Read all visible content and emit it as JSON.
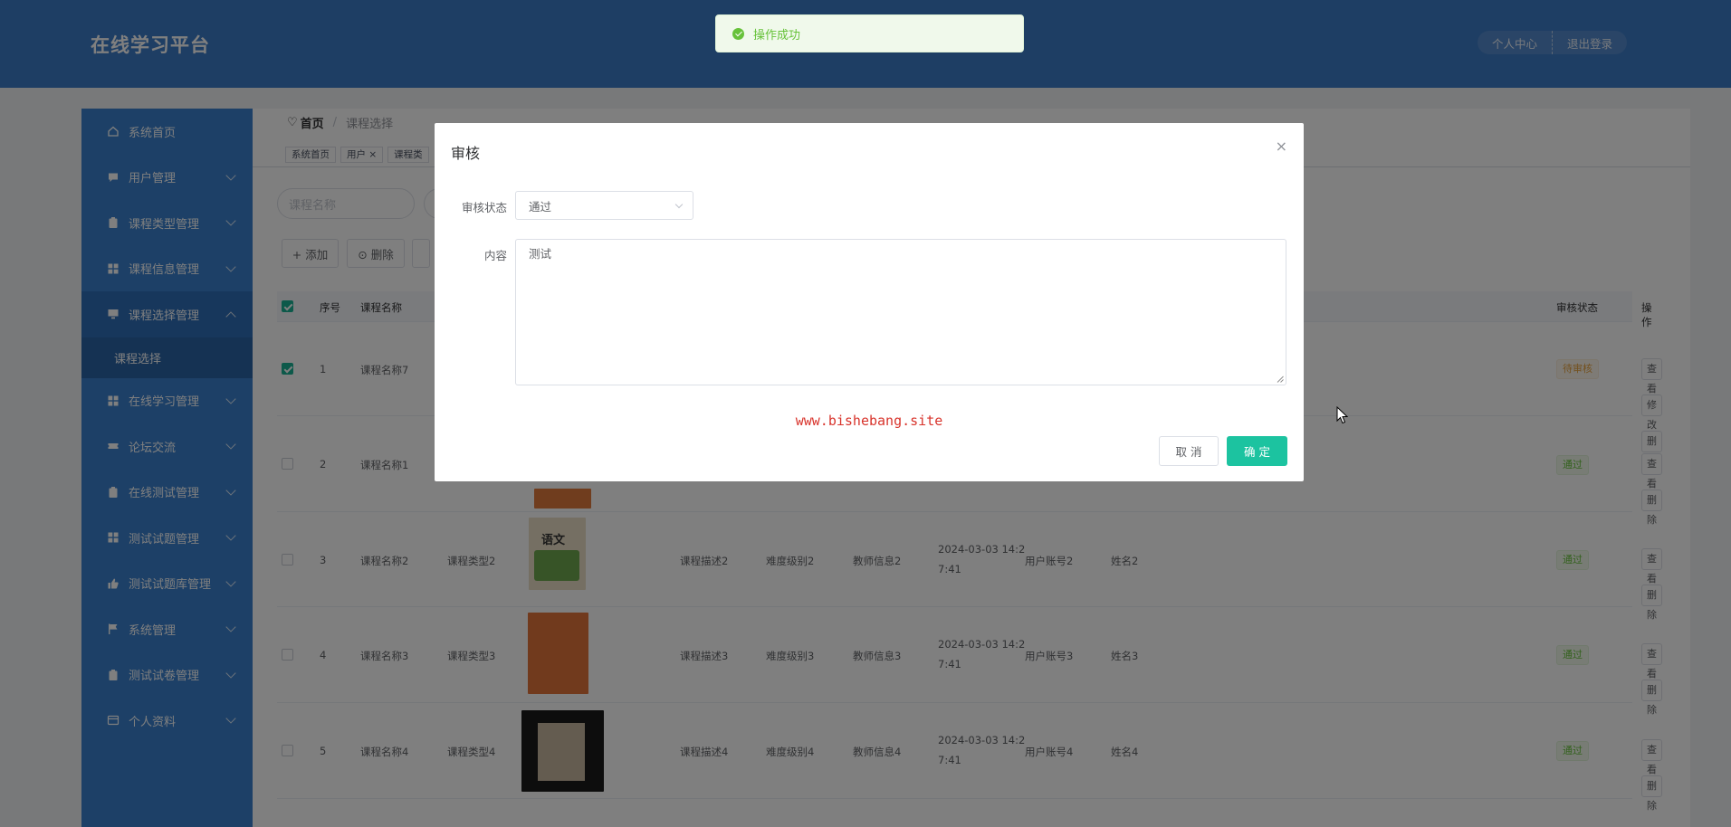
{
  "header": {
    "brand": "在线学习平台",
    "personal_center": "个人中心",
    "logout": "退出登录"
  },
  "sidebar": {
    "items": [
      {
        "label": "系统首页",
        "icon": "home-icon"
      },
      {
        "label": "用户管理",
        "icon": "chat-icon"
      },
      {
        "label": "课程类型管理",
        "icon": "clipboard-icon"
      },
      {
        "label": "课程信息管理",
        "icon": "grid-icon"
      },
      {
        "label": "课程选择管理",
        "icon": "monitor-icon"
      },
      {
        "label": "在线学习管理",
        "icon": "grid-icon"
      },
      {
        "label": "论坛交流",
        "icon": "ticket-icon"
      },
      {
        "label": "在线测试管理",
        "icon": "clipboard-icon"
      },
      {
        "label": "测试试题管理",
        "icon": "grid-icon"
      },
      {
        "label": "测试试题库管理",
        "icon": "thumb-icon"
      },
      {
        "label": "系统管理",
        "icon": "flag-icon"
      },
      {
        "label": "测试试卷管理",
        "icon": "clipboard-icon"
      },
      {
        "label": "个人资料",
        "icon": "card-icon"
      }
    ],
    "subitem": "课程选择"
  },
  "breadcrumb": {
    "home": "首页",
    "current": "课程选择"
  },
  "tags": [
    "系统首页",
    "用户 ×",
    "课程类"
  ],
  "search": {
    "placeholder": "课程名称"
  },
  "toolbar": {
    "add": "+ 添加",
    "delete": "⊙ 删除"
  },
  "table": {
    "headers": {
      "index": "序号",
      "name": "课程名称",
      "status": "审核状态",
      "ops": "操作"
    },
    "rows": [
      {
        "idx": "1",
        "name": "课程名称7",
        "type": "",
        "desc": "",
        "level": "",
        "teacher": "",
        "time1": "",
        "time2": "",
        "account": "",
        "user": "",
        "status": "待审核",
        "actions": [
          "查看",
          "修改",
          "删除"
        ],
        "checked": true
      },
      {
        "idx": "2",
        "name": "课程名称1",
        "type": "",
        "desc": "",
        "level": "",
        "teacher": "",
        "time1": "",
        "time2": "",
        "account": "",
        "user": "",
        "status": "通过",
        "actions": [
          "查看",
          "删除"
        ],
        "checked": false
      },
      {
        "idx": "3",
        "name": "课程名称2",
        "type": "课程类型2",
        "desc": "课程描述2",
        "level": "难度级别2",
        "teacher": "教师信息2",
        "time1": "2024-03-03 14:2",
        "time2": "7:41",
        "account": "用户账号2",
        "user": "姓名2",
        "status": "通过",
        "actions": [
          "查看",
          "删除"
        ],
        "checked": false
      },
      {
        "idx": "4",
        "name": "课程名称3",
        "type": "课程类型3",
        "desc": "课程描述3",
        "level": "难度级别3",
        "teacher": "教师信息3",
        "time1": "2024-03-03 14:2",
        "time2": "7:41",
        "account": "用户账号3",
        "user": "姓名3",
        "status": "通过",
        "actions": [
          "查看",
          "删除"
        ],
        "checked": false
      },
      {
        "idx": "5",
        "name": "课程名称4",
        "type": "课程类型4",
        "desc": "课程描述4",
        "level": "难度级别4",
        "teacher": "教师信息4",
        "time1": "2024-03-03 14:2",
        "time2": "7:41",
        "account": "用户账号4",
        "user": "姓名4",
        "status": "通过",
        "actions": [
          "查看",
          "删除"
        ],
        "checked": false
      }
    ]
  },
  "toast": {
    "message": "操作成功"
  },
  "dialog": {
    "title": "审核",
    "status_label": "审核状态",
    "status_value": "通过",
    "content_label": "内容",
    "content_value": "测试",
    "watermark": "www.bishebang.site",
    "cancel": "取 消",
    "confirm": "确 定"
  },
  "colors": {
    "header_bg": "#3d7cc8",
    "sidebar_bg": "#3a80cf",
    "primary": "#1cc3a0",
    "success": "#67c23a",
    "warning": "#e6a23c"
  }
}
